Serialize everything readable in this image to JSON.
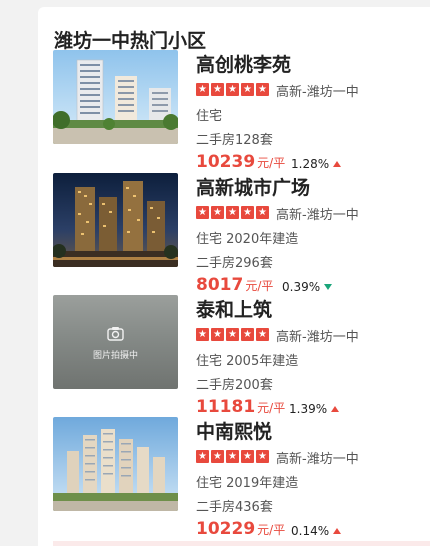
{
  "section": {
    "title": "潍坊一中热门小区"
  },
  "communities": [
    {
      "name": "高创桃李苑",
      "rating_stars": 5,
      "district": "高新-潍坊一中",
      "type_line": "住宅",
      "listings": "二手房128套",
      "price": "10239",
      "price_unit": "元/平",
      "change": "1.28%",
      "trend": "up",
      "image": "apartment-photo"
    },
    {
      "name": "高新城市广场",
      "rating_stars": 5,
      "district": "高新-潍坊一中",
      "type_line": "住宅 2020年建造",
      "listings": "二手房296套",
      "price": "8017",
      "price_unit": "元/平",
      "change": "0.39%",
      "trend": "down",
      "image": "night-towers-photo"
    },
    {
      "name": "泰和上筑",
      "rating_stars": 5,
      "district": "高新-潍坊一中",
      "type_line": "住宅 2005年建造",
      "listings": "二手房200套",
      "price": "11181",
      "price_unit": "元/平",
      "change": "1.39%",
      "trend": "up",
      "image": "placeholder",
      "placeholder_text": "图片拍摄中"
    },
    {
      "name": "中南熙悦",
      "rating_stars": 5,
      "district": "高新-潍坊一中",
      "type_line": "住宅 2019年建造",
      "listings": "二手房436套",
      "price": "10229",
      "price_unit": "元/平",
      "change": "0.14%",
      "trend": "up",
      "image": "skyline-photo"
    }
  ],
  "colors": {
    "accent_red": "#e8493d",
    "trend_down_green": "#1aa57a",
    "text_dark": "#222222",
    "text_muted": "#555555"
  }
}
